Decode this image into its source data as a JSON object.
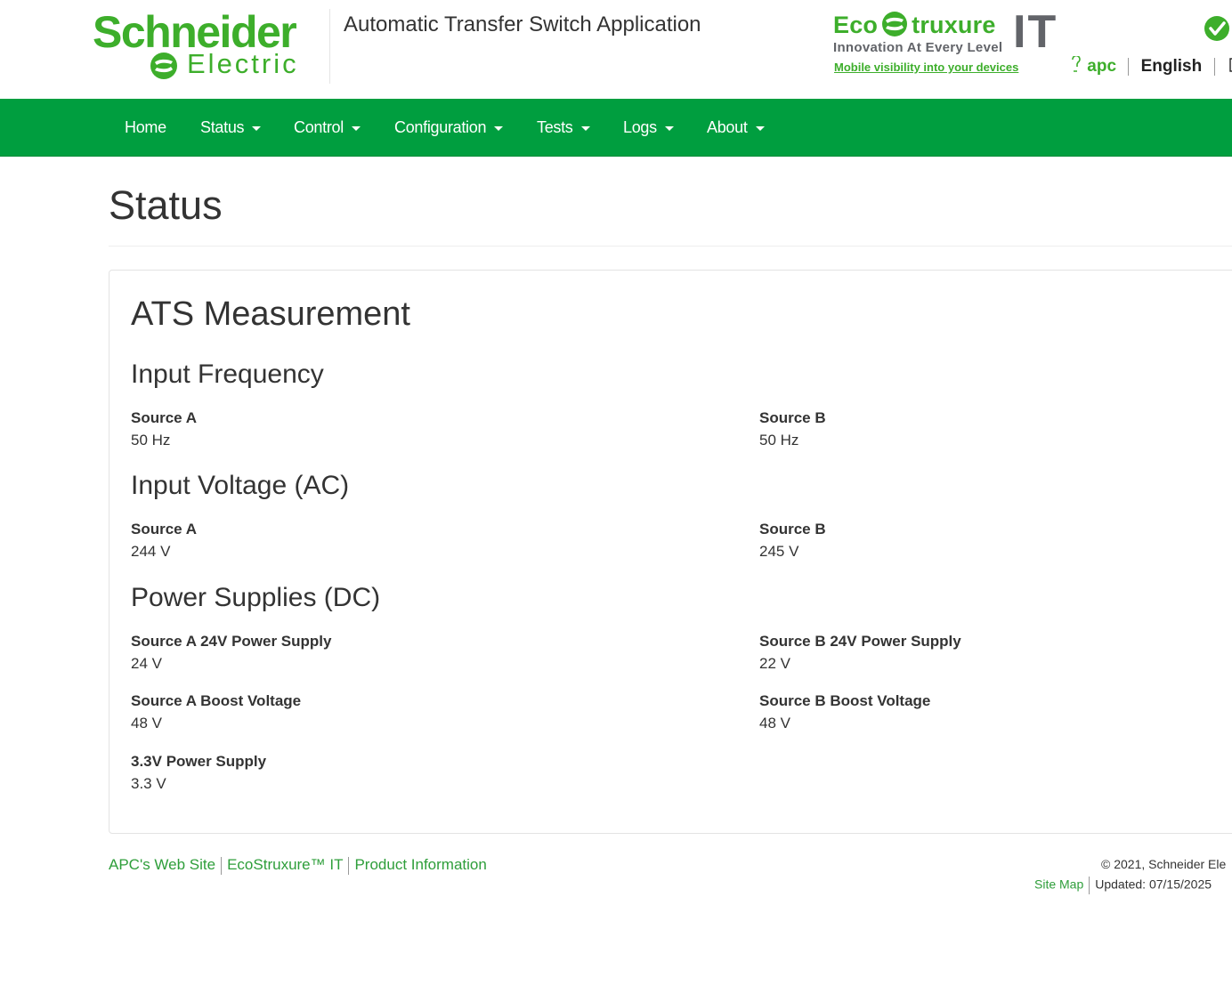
{
  "header": {
    "logo_top": "Schneider",
    "logo_bottom": "Electric",
    "app_title": "Automatic Transfer Switch Application",
    "eco": {
      "eco_word_left": "Eco",
      "eco_word_right": "truxure",
      "it": "IT",
      "tagline": "Innovation At Every Level",
      "link": "Mobile visibility into your devices"
    },
    "user": "apc",
    "language": "English",
    "logout": "Lo",
    "colors": {
      "brand_green": "#3dae2b",
      "nav_green": "#009e3f",
      "status_ok": "#3dae2b"
    }
  },
  "nav": {
    "items": [
      {
        "label": "Home"
      },
      {
        "label": "Status"
      },
      {
        "label": "Control"
      },
      {
        "label": "Configuration"
      },
      {
        "label": "Tests"
      },
      {
        "label": "Logs"
      },
      {
        "label": "About"
      }
    ]
  },
  "page": {
    "title": "Status",
    "panel_title": "ATS Measurement",
    "sections": [
      {
        "title": "Input Frequency",
        "fields": [
          {
            "label": "Source A",
            "value": "50 Hz"
          },
          {
            "label": "Source B",
            "value": "50 Hz"
          }
        ]
      },
      {
        "title": "Input Voltage (AC)",
        "fields": [
          {
            "label": "Source A",
            "value": "244 V"
          },
          {
            "label": "Source B",
            "value": "245 V"
          }
        ]
      },
      {
        "title": "Power Supplies (DC)",
        "fields": [
          {
            "label": "Source A 24V Power Supply",
            "value": "24 V"
          },
          {
            "label": "Source B 24V Power Supply",
            "value": "22 V"
          },
          {
            "label": "Source A Boost Voltage",
            "value": "48 V"
          },
          {
            "label": "Source B Boost Voltage",
            "value": "48 V"
          },
          {
            "label": "3.3V Power Supply",
            "value": "3.3 V"
          }
        ]
      }
    ]
  },
  "footer": {
    "links": [
      "APC's Web Site",
      "EcoStruxure™ IT",
      "Product Information"
    ],
    "copyright": "© 2021, Schneider Ele",
    "site_map": "Site Map",
    "updated": "Updated: 07/15/2025"
  }
}
